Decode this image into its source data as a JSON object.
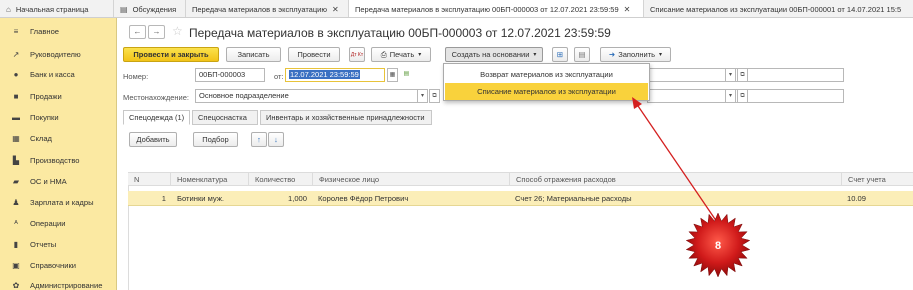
{
  "tabs": [
    {
      "label": "Начальная страница",
      "icon": "home-icon",
      "closable": false
    },
    {
      "label": "Обсуждения",
      "icon": "chat-icon",
      "closable": false
    },
    {
      "label": "Передача материалов в эксплуатацию",
      "closable": true
    },
    {
      "label": "Передача материалов в эксплуатацию 00БП-000003 от 12.07.2021 23:59:59",
      "closable": true
    },
    {
      "label": "Списание материалов из эксплуатации 00БП-000001 от 14.07.2021 15:5",
      "closable": false
    }
  ],
  "sidebar": {
    "items": [
      {
        "label": "Главное",
        "icon": "menu-lines-icon"
      },
      {
        "label": "Руководителю",
        "icon": "trend-icon"
      },
      {
        "label": "Банк и касса",
        "icon": "coin-icon"
      },
      {
        "label": "Продажи",
        "icon": "bag-icon"
      },
      {
        "label": "Покупки",
        "icon": "cart-icon"
      },
      {
        "label": "Склад",
        "icon": "warehouse-icon"
      },
      {
        "label": "Производство",
        "icon": "factory-icon"
      },
      {
        "label": "ОС и НМА",
        "icon": "truck-icon"
      },
      {
        "label": "Зарплата и кадры",
        "icon": "person-icon"
      },
      {
        "label": "Операции",
        "icon": "operations-icon"
      },
      {
        "label": "Отчеты",
        "icon": "bar-chart-icon"
      },
      {
        "label": "Справочники",
        "icon": "book-icon"
      },
      {
        "label": "Администрирование",
        "icon": "gear-icon"
      }
    ]
  },
  "header": {
    "title": "Передача материалов в эксплуатацию 00БП-000003 от 12.07.2021 23:59:59",
    "back": "←",
    "forward": "→",
    "star": "☆"
  },
  "toolbar": {
    "post_close": "Провести и закрыть",
    "save": "Записать",
    "post": "Провести",
    "dt_kt": "Дт Кт",
    "print": "Печать",
    "create_based": "Создать на основании",
    "fill": "Заполнить"
  },
  "dropdown": {
    "items": [
      {
        "label": "Возврат материалов из эксплуатации",
        "highlighted": false
      },
      {
        "label": "Списание материалов из эксплуатации",
        "highlighted": true
      }
    ]
  },
  "form": {
    "number_label": "Номер:",
    "number_value": "00БП-000003",
    "date_label": "от:",
    "date_value": "12.07.2021 23:59:59",
    "location_label": "Местонахождение:",
    "location_value": "Основное подразделение"
  },
  "subtabs": [
    {
      "label": "Спецодежда (1)",
      "active": true
    },
    {
      "label": "Спецоснастка",
      "active": false
    },
    {
      "label": "Инвентарь и хозяйственные принадлежности",
      "active": false
    }
  ],
  "table_toolbar": {
    "add": "Добавить",
    "pick": "Подбор",
    "up": "↑",
    "down": "↓"
  },
  "table": {
    "columns": [
      "N",
      "Номенклатура",
      "Количество",
      "Физическое лицо",
      "Способ отражения расходов",
      "Счет учета"
    ],
    "rows": [
      {
        "n": "1",
        "item": "Ботинки муж.",
        "qty": "1,000",
        "person": "Королев Фёдор Петрович",
        "method": "Счет 26; Материальные расходы",
        "account": "10.09"
      }
    ]
  },
  "callout": {
    "label": "8"
  },
  "colors": {
    "sidebar_bg": "#fbe9a2",
    "primary_button": "#f2c318",
    "highlight": "#f9d23c",
    "selected_row": "#fbeeb8",
    "callout_red": "#c0141a",
    "arrow_red": "#d42020"
  }
}
